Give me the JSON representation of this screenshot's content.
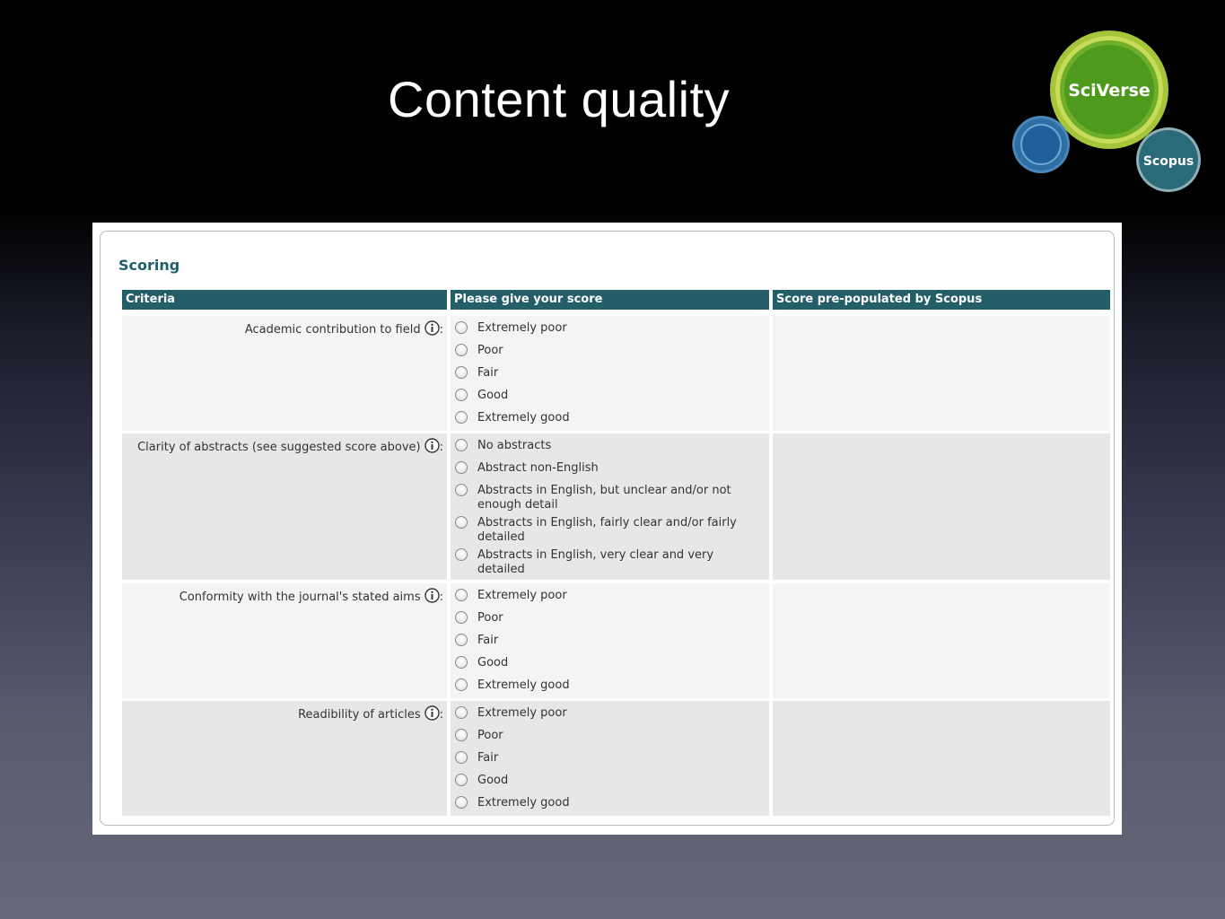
{
  "slide": {
    "title": "Content quality"
  },
  "logo": {
    "main": "SciVerse",
    "secondary": "Scopus"
  },
  "panel": {
    "heading": "Scoring",
    "columns": [
      "Criteria",
      "Please give your score",
      "Score pre-populated by Scopus"
    ],
    "rows": [
      {
        "criteria": "Academic contribution to field",
        "colon": ":",
        "options": [
          "Extremely poor",
          "Poor",
          "Fair",
          "Good",
          "Extremely good"
        ],
        "prepopulated": ""
      },
      {
        "criteria": "Clarity of abstracts (see suggested score above)",
        "colon": ":",
        "options": [
          "No abstracts",
          "Abstract non-English",
          "Abstracts in English, but unclear and/or not enough detail",
          "Abstracts in English, fairly clear and/or fairly detailed",
          "Abstracts in English, very clear and very detailed"
        ],
        "prepopulated": ""
      },
      {
        "criteria": "Conformity with the journal's stated aims",
        "colon": ":",
        "options": [
          "Extremely poor",
          "Poor",
          "Fair",
          "Good",
          "Extremely good"
        ],
        "prepopulated": ""
      },
      {
        "criteria": "Readibility of articles",
        "colon": ":",
        "options": [
          "Extremely poor",
          "Poor",
          "Fair",
          "Good",
          "Extremely good"
        ],
        "prepopulated": ""
      }
    ]
  },
  "colors": {
    "header": "#245e68",
    "heading": "#1f5f6b",
    "sciverse_green": "#4d9a1c",
    "scopus_teal": "#2b6a78"
  }
}
